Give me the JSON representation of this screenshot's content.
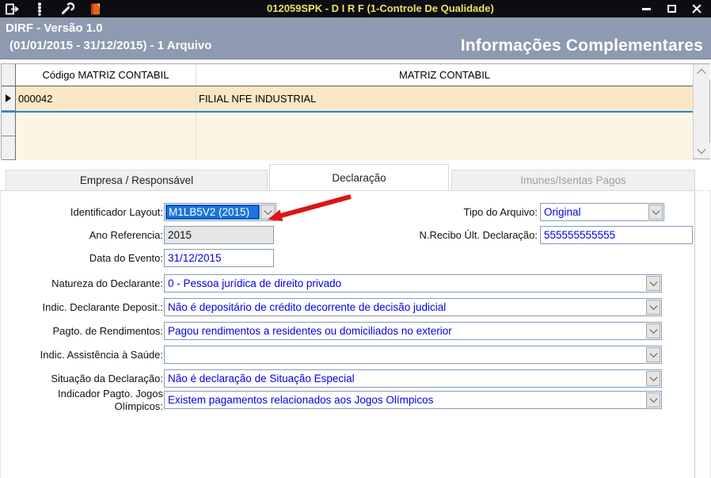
{
  "window": {
    "title": "012059SPK - D I R F (1-Controle De Qualidade)",
    "toolbar_icons": [
      "exit-icon",
      "traffic-light-icon",
      "wrench-icon",
      "notebook-icon"
    ],
    "window_buttons": [
      "minimize",
      "maximize",
      "close"
    ]
  },
  "header": {
    "line1": "DIRF - Versão 1.0",
    "line2": "(01/01/2015 - 31/12/2015) - 1 Arquivo",
    "section_title": "Informações Complementares"
  },
  "grid": {
    "columns": [
      "Código MATRIZ CONTABIL",
      "MATRIZ CONTABIL"
    ],
    "rows": [
      {
        "codigo": "000042",
        "matriz": "FILIAL NFE INDUSTRIAL"
      }
    ]
  },
  "tabs": [
    {
      "label": "Empresa / Responsável",
      "state": "inactive"
    },
    {
      "label": "Declaração",
      "state": "active"
    },
    {
      "label": "Imunes/Isentas Pagos",
      "state": "disabled"
    }
  ],
  "form": {
    "identificador_layout": {
      "label": "Identificador Layout:",
      "value": "M1LB5V2 (2015)"
    },
    "tipo_arquivo": {
      "label": "Tipo do Arquivo:",
      "value": "Original"
    },
    "ano_referencia": {
      "label": "Ano Referencia:",
      "value": "2015"
    },
    "recibo_ult_declaracao": {
      "label": "N.Recibo Últ. Declaração:",
      "value": "555555555555"
    },
    "data_evento": {
      "label": "Data do Evento:",
      "value": "31/12/2015"
    },
    "natureza_declarante": {
      "label": "Natureza do Declarante:",
      "value": "0 - Pessoa jurídica de direito privado"
    },
    "indic_declarante_deposit": {
      "label": "Indic. Declarante Deposit.:",
      "value": "Não é depositário de crédito decorrente de decisão judicial"
    },
    "pagto_rendimentos": {
      "label": "Pagto. de Rendimentos:",
      "value": "Pagou rendimentos a residentes ou domiciliados no exterior"
    },
    "indic_assistencia_saude": {
      "label": "Indic. Assistência à Saúde:",
      "value": ""
    },
    "situacao_declaracao": {
      "label": "Situação da Declaração:",
      "value": "Não é declaração de Situação Especial"
    },
    "indicador_pagto_jogos": {
      "label": "Indicador Pagto. Jogos Olímpicos:",
      "value": "Existem pagamentos relacionados aos Jogos Olímpicos"
    }
  },
  "colors": {
    "titlebar_background": "#0c0c12",
    "title_text_yellow": "#e9e464",
    "band_background": "#8d9aaf",
    "grid_selected_row": "#fae7c3",
    "grid_row": "#fdf5e3",
    "selection_blue": "#1b74dd",
    "value_text_blue": "#0000e8",
    "annotation_red": "#dd1414"
  }
}
